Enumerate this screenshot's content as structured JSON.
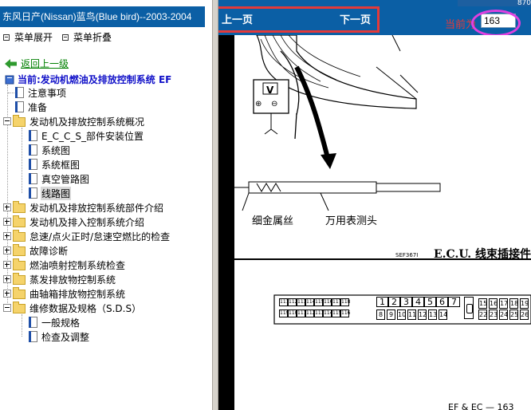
{
  "left_pane": {
    "title": "东风日产(Nissan)蓝鸟(Blue bird)--2003-2004",
    "expand_label": "菜单展开",
    "collapse_label": "菜单折叠",
    "back_label": "返回上一级",
    "current_label": "当前:发动机燃油及排放控制系统 EF",
    "tree": [
      {
        "label": "注意事项",
        "type": "doc"
      },
      {
        "label": "准备",
        "type": "doc"
      },
      {
        "label": "发动机及排放控制系统概况",
        "type": "folder",
        "expanded": true
      },
      {
        "label": "E_C_C_S_部件安装位置",
        "type": "doc"
      },
      {
        "label": "系统图",
        "type": "doc"
      },
      {
        "label": "系统框图",
        "type": "doc"
      },
      {
        "label": "真空管路图",
        "type": "doc"
      },
      {
        "label": "线路图",
        "type": "doc",
        "selected": true
      },
      {
        "label": "发动机及排放控制系统部件介绍",
        "type": "folder"
      },
      {
        "label": "发动机及排入控制系统介绍",
        "type": "folder"
      },
      {
        "label": "怠速/点火正时/怠速空燃比的检查",
        "type": "folder"
      },
      {
        "label": "故障诊断",
        "type": "folder"
      },
      {
        "label": "燃油喷射控制系统检查",
        "type": "folder"
      },
      {
        "label": "蒸发排放物控制系统",
        "type": "folder"
      },
      {
        "label": "曲轴箱排放物控制系统",
        "type": "folder"
      },
      {
        "label": "维修数据及规格（S.D.S）",
        "type": "folder",
        "expanded": true
      },
      {
        "label": "一般规格",
        "type": "doc"
      },
      {
        "label": "检查及调整",
        "type": "doc"
      }
    ]
  },
  "viewer": {
    "prev_label": "上一页",
    "next_label": "下一页",
    "current_page_label": "当前为",
    "current_page_value": "163",
    "top_strip_text": "870",
    "colors": {
      "bar": "#0b5fa5",
      "highlight_box": "#e33a3a",
      "callout": "#e040e0"
    }
  },
  "document_page": {
    "meter_label": "V",
    "meter_plus": "⊕",
    "meter_minus": "⊖",
    "caption_wire": "细金属丝",
    "caption_probe": "万用表测头",
    "figure_code": "SEF367I",
    "ecu_title": "E.C.U. 线束插接件",
    "footer": "EF & EC — 163",
    "connector_top_small": [
      "111",
      "112",
      "113",
      "114",
      "115",
      "116",
      "117",
      "118"
    ],
    "connector_bottom_small": [
      "119",
      "110",
      "111",
      "112",
      "113",
      "114",
      "115",
      "116"
    ],
    "connector_top_big": [
      "1",
      "2",
      "3",
      "4",
      "5",
      "6",
      "7"
    ],
    "connector_bottom_big": [
      "8",
      "9",
      "10",
      "11",
      "12",
      "13",
      "14"
    ],
    "connector_right_top": [
      "15",
      "16",
      "17",
      "18",
      "19"
    ],
    "connector_right_bottom": [
      "22",
      "23",
      "24",
      "25",
      "26"
    ]
  }
}
